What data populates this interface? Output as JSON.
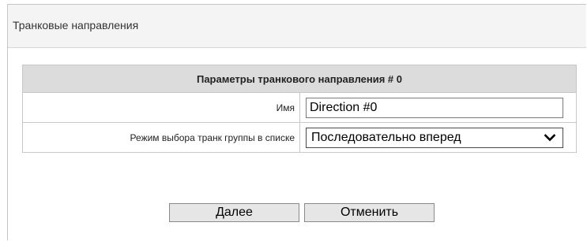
{
  "header": {
    "title": "Транковые направления"
  },
  "params": {
    "table_title": "Параметры транкового направления # 0",
    "name_label": "Имя",
    "name_value": "Direction #0",
    "mode_label": "Режим выбора транк группы в списке",
    "mode_value": "Последовательно вперед",
    "mode_icon": "chevron-down-icon"
  },
  "actions": {
    "next_label": "Далее",
    "cancel_label": "Отменить"
  },
  "colors": {
    "header_bg": "#f4f4f4",
    "table_title_bg": "#dcdcdc",
    "button_bg": "#e6e6e6"
  }
}
